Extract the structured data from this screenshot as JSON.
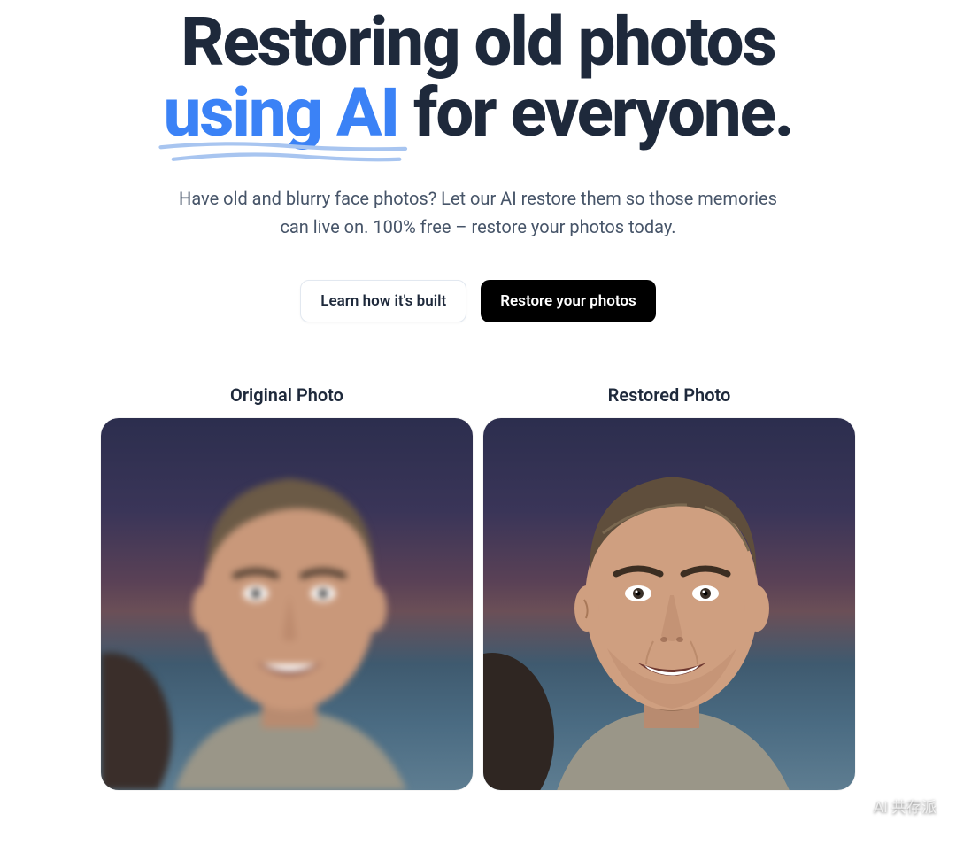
{
  "hero": {
    "line1": "Restoring old photos",
    "highlight": "using AI",
    "line2_rest": " for everyone."
  },
  "subtitle": "Have old and blurry face photos? Let our AI restore them so those memories can live on. 100% free – restore your photos today.",
  "buttons": {
    "secondary": "Learn how it's built",
    "primary": "Restore your photos"
  },
  "photos": {
    "original_label": "Original Photo",
    "restored_label": "Restored Photo"
  },
  "watermark": {
    "label": "AI 共存派"
  },
  "colors": {
    "accent": "#3b82f6",
    "text_dark": "#1e293b",
    "text_muted": "#475569",
    "btn_primary_bg": "#000000"
  }
}
